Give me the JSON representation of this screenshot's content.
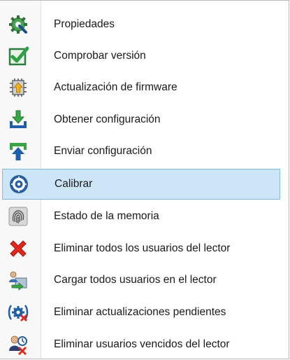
{
  "menu": {
    "items": [
      {
        "label": "Propiedades",
        "icon": "gear-wrench-icon"
      },
      {
        "label": "Comprobar versión",
        "icon": "checkmark-box-icon"
      },
      {
        "label": "Actualización de firmware",
        "icon": "chip-upload-icon"
      },
      {
        "label": "Obtener configuración",
        "icon": "download-tray-icon"
      },
      {
        "label": "Enviar configuración",
        "icon": "upload-arrow-icon"
      },
      {
        "label": "Calibrar",
        "icon": "target-icon",
        "selected": true
      },
      {
        "label": "Estado de la memoria",
        "icon": "fingerprint-icon"
      },
      {
        "label": "Eliminar todos los usuarios del lector",
        "icon": "red-x-icon"
      },
      {
        "label": "Cargar todos usuarios en el lector",
        "icon": "user-transfer-icon"
      },
      {
        "label": "Eliminar actualizaciones pendientes",
        "icon": "gear-delete-icon"
      },
      {
        "label": "Eliminar usuarios vencidos del lector",
        "icon": "user-expired-icon"
      }
    ]
  },
  "colors": {
    "selection_bg": "#cde6f7",
    "selection_border": "#84b9df"
  }
}
